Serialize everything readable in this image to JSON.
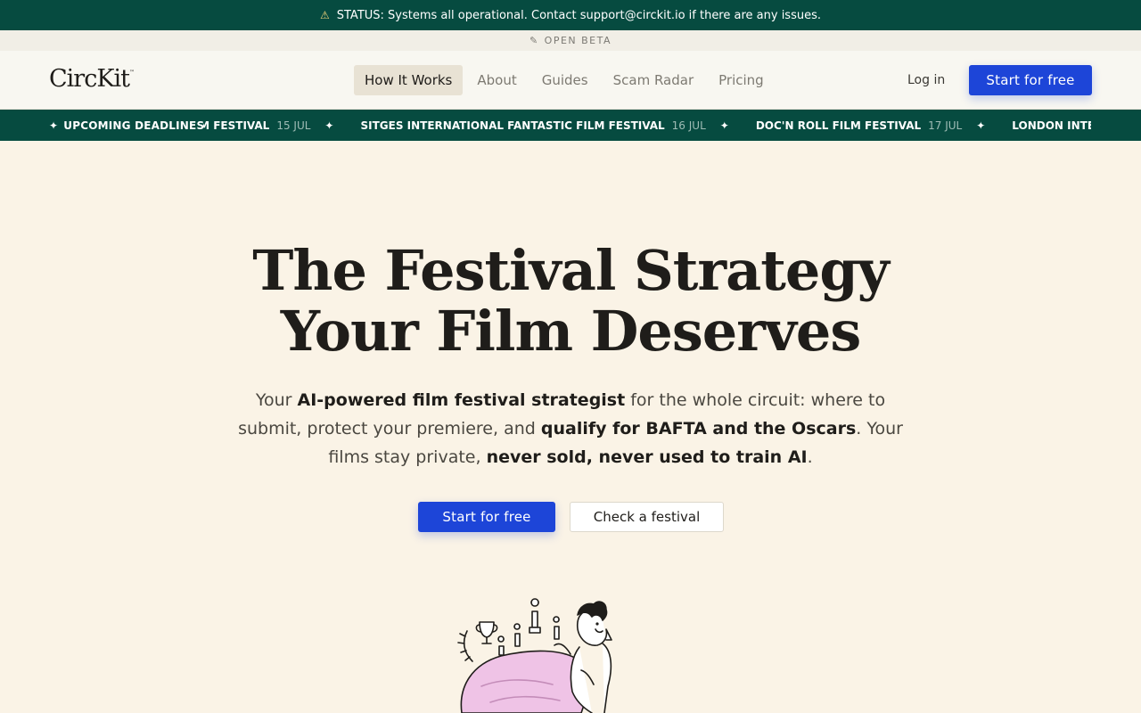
{
  "status": {
    "icon": "warning-icon",
    "text": "STATUS: Systems all operational. Contact support@circkit.io if there are any issues."
  },
  "beta": {
    "icon": "wrench-icon",
    "text": "OPEN BETA"
  },
  "nav": {
    "logo": "CircKit",
    "logo_tm": "™",
    "links": [
      {
        "label": "How It Works",
        "active": true
      },
      {
        "label": "About"
      },
      {
        "label": "Guides"
      },
      {
        "label": "Scam Radar"
      },
      {
        "label": "Pricing"
      }
    ],
    "login": "Log in",
    "cta": "Start for free"
  },
  "ticker": {
    "label": "UPCOMING DEADLINES",
    "items": [
      {
        "name": "ILM FESTIVAL",
        "date": "15 JUL"
      },
      {
        "name": "SITGES INTERNATIONAL FANTASTIC FILM FESTIVAL",
        "date": "16 JUL"
      },
      {
        "name": "DOC'N ROLL FILM FESTIVAL",
        "date": "17 JUL"
      },
      {
        "name": "LONDON INTERNATIONAL ANIMATIO",
        "date": ""
      }
    ]
  },
  "hero": {
    "title_line1": "The Festival Strategy",
    "title_line2": "Your Film Deserves",
    "sub_1": "Your ",
    "sub_b1": "AI-powered film festival strategist",
    "sub_2": " for the whole circuit: where to submit, protect your premiere, and ",
    "sub_b2": "qualify for BAFTA and the Oscars",
    "sub_3": ". Your films stay private, ",
    "sub_b3": "never sold, never used to train AI",
    "sub_4": ".",
    "cta_primary": "Start for free",
    "cta_secondary": "Check a festival"
  },
  "colors": {
    "brand_green": "#064b40",
    "brand_blue": "#1d45d8",
    "cream": "#faf3e6"
  }
}
